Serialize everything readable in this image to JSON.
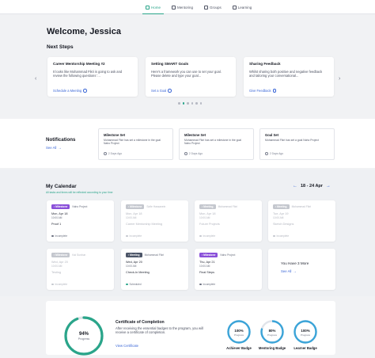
{
  "nav": {
    "items": [
      {
        "label": "Home",
        "icon": "home-icon",
        "active": true
      },
      {
        "label": "Mentoring",
        "icon": "mentoring-icon",
        "active": false
      },
      {
        "label": "Groups",
        "icon": "groups-icon",
        "active": false
      },
      {
        "label": "Learning",
        "icon": "learning-icon",
        "active": false
      }
    ]
  },
  "welcome": {
    "title": "Welcome, Jessica"
  },
  "next_steps": {
    "heading": "Next Steps",
    "cards": [
      {
        "title": "Career Mentorship Meeting #2",
        "body": "It looks like Mohammad Fikri is going to ask and review the following questions '...",
        "link": "Schedule a Meeting"
      },
      {
        "title": "Setting SMART Goals",
        "body": "Here's a framework you can use to set your goal. Please delete and type your goal...",
        "link": "Set a Goal"
      },
      {
        "title": "Sharing Feedback",
        "body": "Whilst sharing both positive and negative feedback and tailoring your conversational...",
        "link": "Give Feedback"
      }
    ],
    "pager": {
      "count": 6,
      "active": 1
    }
  },
  "notifications": {
    "heading": "Notifications",
    "see_all": "See All",
    "items": [
      {
        "title": "Milestone Set",
        "body": "Mohammad Fikri has set a milestone in the goal Naho Project",
        "time": "2 Days Ago"
      },
      {
        "title": "Milestone Set",
        "body": "Mohammad Fikri has set a milestone in the goal Naho Project",
        "time": "2 Days Ago"
      },
      {
        "title": "Goal Set",
        "body": "Mohammad Fikri has set a goal Naho Project",
        "time": "2 Days Ago"
      }
    ]
  },
  "calendar": {
    "heading": "My Calendar",
    "subtitle": "All tasks and times will be reflected according to your time",
    "range": "18 - 24 Apr",
    "events": [
      {
        "type": "Milestone",
        "project": "Naho Project",
        "date": "Mon, Apr 18",
        "time": "10:00 AM",
        "title": "Proof 1",
        "status": "Incomplete",
        "muted": false
      },
      {
        "type": "Milestone",
        "project": "Sofie Hassanein",
        "date": "Mon, Apr 18",
        "time": "10:00 AM",
        "title": "Career Mentorship Meeting",
        "status": "Incomplete",
        "muted": true
      },
      {
        "type": "Meeting",
        "project": "Mohammad Fikri",
        "date": "Mon, Apr 18",
        "time": "10:00 AM",
        "title": "Future Projects",
        "status": "Incomplete",
        "muted": true
      },
      {
        "type": "Meeting",
        "project": "Mohammad Fikri",
        "date": "Tue, Apr 19",
        "time": "10:00 AM",
        "title": "Sketch Designs",
        "status": "Incomplete",
        "muted": true
      },
      {
        "type": "Milestone",
        "project": "Kai Sunbun",
        "date": "Wed, Apr 20",
        "time": "10:00 AM",
        "title": "Testing",
        "status": "Incomplete",
        "muted": true
      },
      {
        "type": "Meeting",
        "project": "Mohammad Fikri",
        "date": "Wed, Apr 20",
        "time": "10:00 AM",
        "title": "Check-In Meeting",
        "status": "Scheduled",
        "muted": false
      },
      {
        "type": "Milestone",
        "project": "Naho Project",
        "date": "Thu, Apr 21",
        "time": "10:00 AM",
        "title": "Final Steps",
        "status": "Incomplete",
        "muted": false
      }
    ],
    "more": {
      "label": "You Have 3 More",
      "link": "See All"
    }
  },
  "certificate": {
    "progress_percent": 94,
    "progress_value": "94%",
    "progress_label": "Progress",
    "title": "Certificate of Completion",
    "body": "After receiving the essential badges to the program, you will receive a certificate of completion.",
    "link": "View Certificate",
    "badges": [
      {
        "name": "Achiever Badge",
        "value": "100%",
        "percent": 100,
        "sub": "Progress"
      },
      {
        "name": "Mentoring Badge",
        "value": "80%",
        "percent": 80,
        "sub": "Progress"
      },
      {
        "name": "Learner Badge",
        "value": "100%",
        "percent": 100,
        "sub": "Progress"
      }
    ]
  },
  "colors": {
    "accent": "#2aa58a",
    "link": "#3a66d6",
    "milestone": "#8a50d9",
    "meeting": "#4c5568",
    "ring_light": "#3ba4d8"
  }
}
